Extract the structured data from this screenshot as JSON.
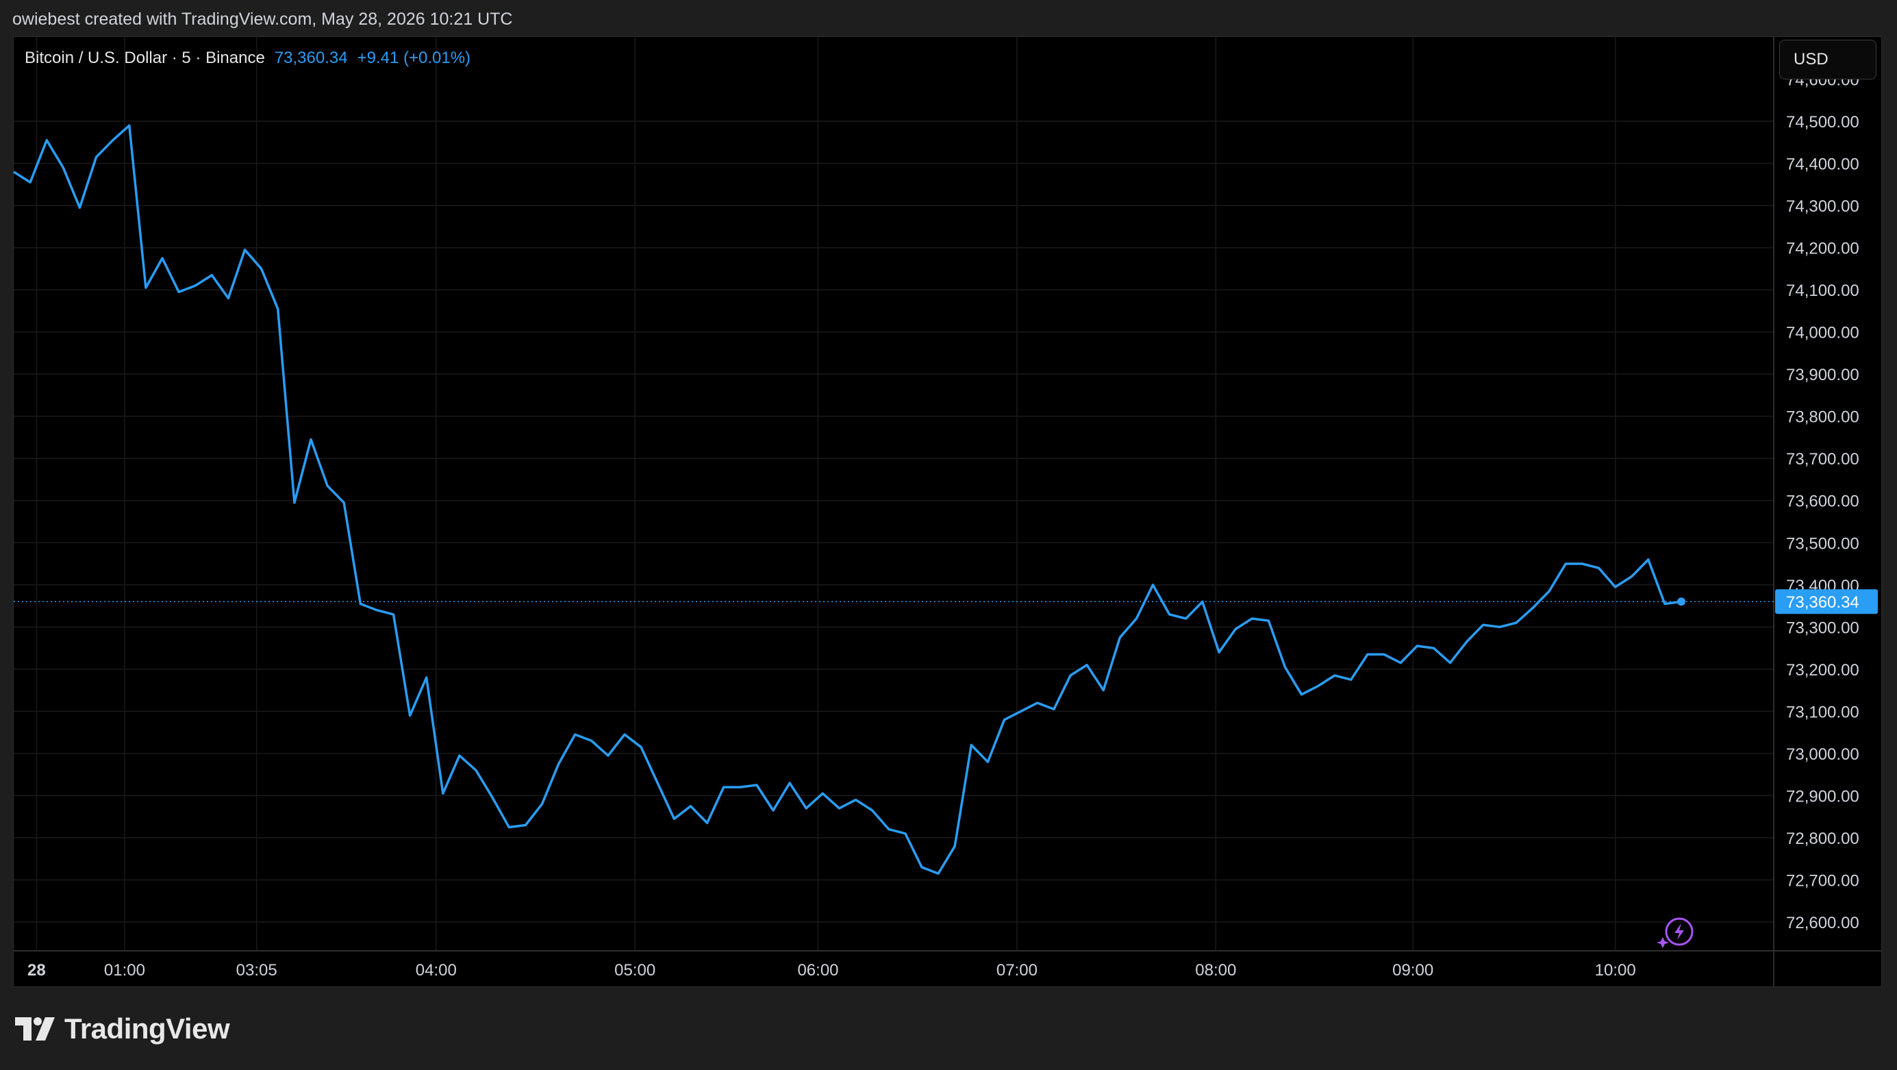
{
  "header": {
    "attribution": "owiebest created with TradingView.com, May 28, 2026 10:21 UTC"
  },
  "legend": {
    "symbol": "Bitcoin / U.S. Dollar · 5 · Binance",
    "price": "73,360.34",
    "change": "+9.41 (+0.01%)"
  },
  "currency_button": {
    "label": "USD"
  },
  "brand": {
    "name": "TradingView"
  },
  "colors": {
    "line": "#2a9df4",
    "price_tag_bg": "#2a9df4",
    "background": "#000000",
    "grid": "#1a1a1a",
    "lightning_icon": "#a855f7"
  },
  "chart_data": {
    "type": "line",
    "ylim": [
      72550,
      74600
    ],
    "y_ticks": [
      72600,
      72700,
      72800,
      72900,
      73000,
      73100,
      73200,
      73300,
      73400,
      73500,
      73600,
      73700,
      73800,
      73900,
      74000,
      74100,
      74200,
      74300,
      74400,
      74500
    ],
    "y_tick_labels": [
      "72,600.00",
      "72,700.00",
      "72,800.00",
      "72,900.00",
      "73,000.00",
      "73,100.00",
      "73,200.00",
      "73,300.00",
      "73,400.00",
      "73,500.00",
      "73,600.00",
      "73,700.00",
      "73,800.00",
      "73,900.00",
      "74,000.00",
      "74,100.00",
      "74,200.00",
      "74,300.00",
      "74,400.00",
      "74,500.00"
    ],
    "top_partial_label": "74,600.00",
    "x_ticks": [
      {
        "label": "28",
        "pos": 0.013,
        "bold": true
      },
      {
        "label": "01:00",
        "pos": 0.063
      },
      {
        "label": "03:05",
        "pos": 0.138
      },
      {
        "label": "04:00",
        "pos": 0.24
      },
      {
        "label": "05:00",
        "pos": 0.353
      },
      {
        "label": "06:00",
        "pos": 0.457
      },
      {
        "label": "07:00",
        "pos": 0.57
      },
      {
        "label": "08:00",
        "pos": 0.683
      },
      {
        "label": "09:00",
        "pos": 0.795
      },
      {
        "label": "10:00",
        "pos": 0.91
      }
    ],
    "last_price": 73360.34,
    "last_price_label": "73,360.34",
    "series": [
      {
        "values": [
          74380,
          74355,
          74455,
          74390,
          74295,
          74415,
          74455,
          74490,
          74105,
          74175,
          74095,
          74110,
          74135,
          74080,
          74195,
          74150,
          74055,
          73595,
          73745,
          73635,
          73595,
          73355,
          73340,
          73330,
          73090,
          73180,
          72905,
          72995,
          72960,
          72895,
          72825,
          72830,
          72880,
          72975,
          73045,
          73030,
          72995,
          73045,
          73015,
          72930,
          72845,
          72875,
          72835,
          72920,
          72920,
          72925,
          72865,
          72930,
          72870,
          72905,
          72870,
          72890,
          72865,
          72820,
          72810,
          72730,
          72715,
          72780,
          73020,
          72980,
          73080,
          73100,
          73120,
          73105,
          73185,
          73210,
          73150,
          73275,
          73320,
          73400,
          73330,
          73320,
          73360,
          73240,
          73295,
          73320,
          73315,
          73205,
          73140,
          73160,
          73185,
          73175,
          73235,
          73235,
          73215,
          73255,
          73250,
          73215,
          73265,
          73305,
          73300,
          73310,
          73345,
          73385,
          73450,
          73450,
          73440,
          73395,
          73420,
          73460,
          73355,
          73360
        ]
      }
    ]
  }
}
